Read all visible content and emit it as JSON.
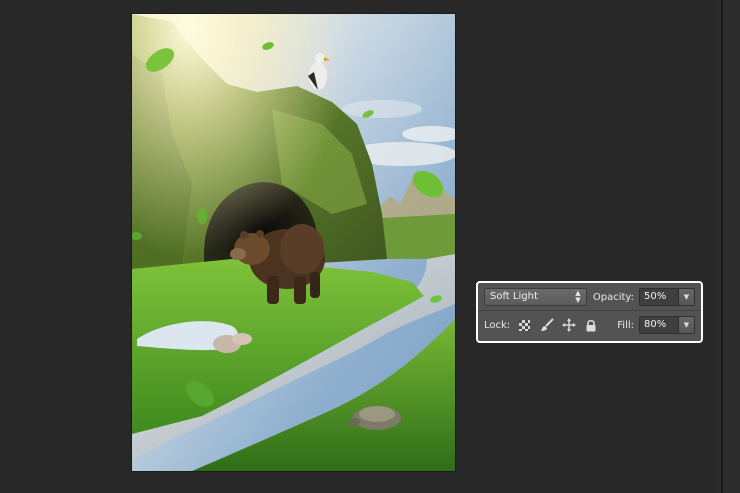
{
  "layers_panel": {
    "blend_mode": "Soft Light",
    "opacity_label": "Opacity:",
    "opacity_value": "50%",
    "lock_label": "Lock:",
    "fill_label": "Fill:",
    "fill_value": "80%",
    "lock_icons": [
      "lock-transparent-pixels-icon",
      "lock-image-pixels-icon",
      "lock-position-icon",
      "lock-all-icon"
    ]
  },
  "colors": {
    "workspace": "#282828",
    "panel": "#535353",
    "panel_outline": "#ffffff",
    "field": "#3f3f3f"
  }
}
